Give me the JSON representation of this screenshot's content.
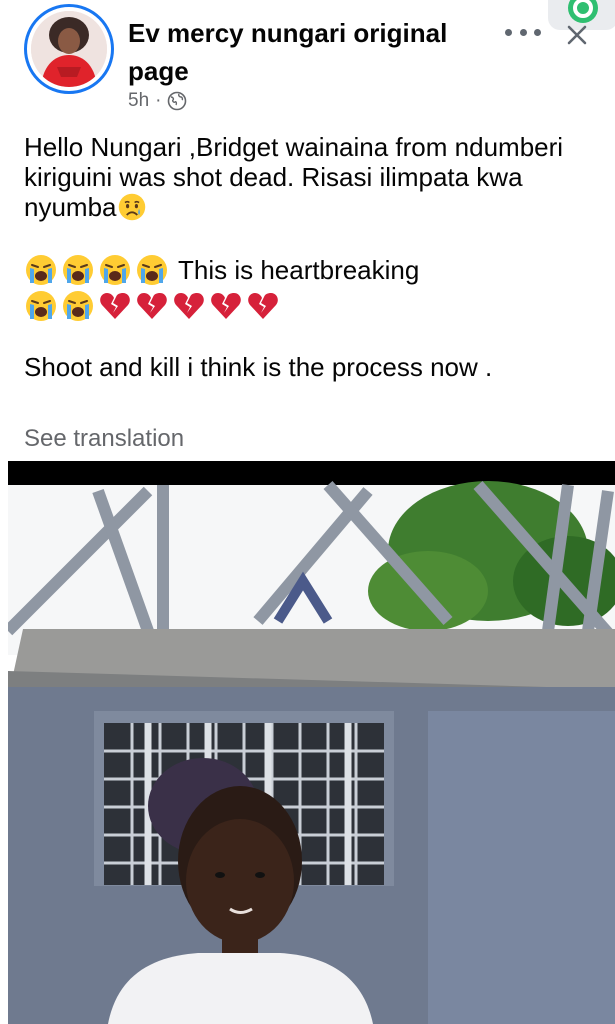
{
  "post": {
    "page_name": "Ev mercy nungari original page",
    "time": "5h",
    "separator": "·",
    "privacy_icon": "globe-icon",
    "more_icon": "more-horizontal-icon",
    "close_icon": "close-icon",
    "text": {
      "line1": "Hello Nungari ,Bridget wainaina from ndumberi kiriguini was shot dead. Risasi ilimpata kwa nyumba",
      "line2": "This is heartbreaking",
      "line3": "Shoot and kill i think is the process now ."
    },
    "emoji": {
      "sad_relieved": "😥",
      "loudly_crying": "😭",
      "broken_heart": "💔"
    },
    "see_translation": "See translation"
  },
  "colors": {
    "brand_blue": "#1877f2",
    "secondary_text": "#65676b",
    "broken_heart_red": "#d6213a"
  }
}
